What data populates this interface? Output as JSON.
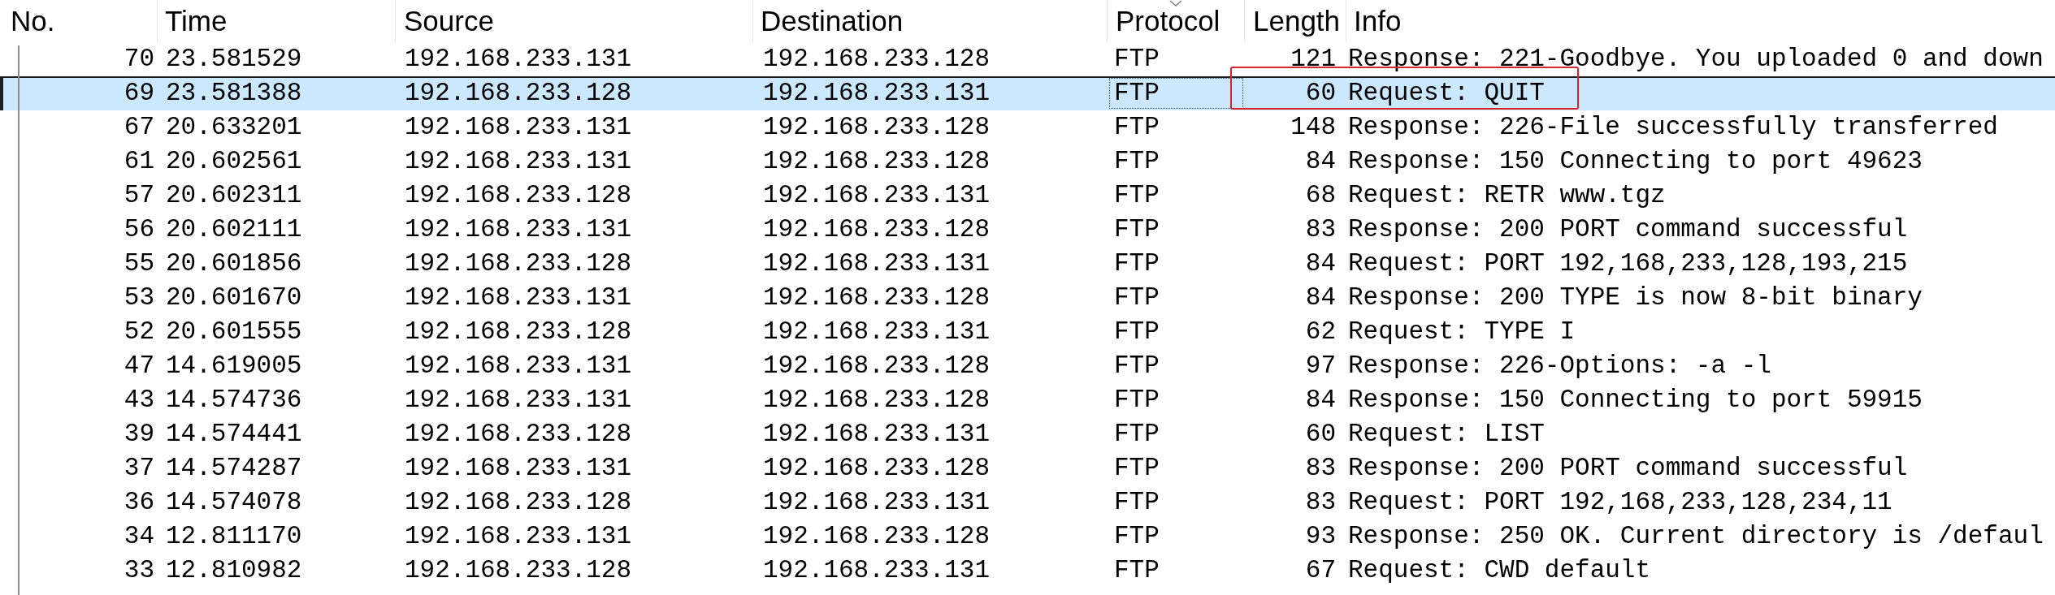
{
  "packet_list": {
    "columns": [
      {
        "label": "No.",
        "sorted": false
      },
      {
        "label": "Time",
        "sorted": false
      },
      {
        "label": "Source",
        "sorted": false
      },
      {
        "label": "Destination",
        "sorted": false
      },
      {
        "label": "Protocol",
        "sorted": true
      },
      {
        "label": "Length",
        "sorted": false
      },
      {
        "label": "Info",
        "sorted": false
      }
    ],
    "rows": [
      {
        "cells": [
          "70",
          "23.581529",
          "192.168.233.131",
          "192.168.233.128",
          "FTP",
          "121",
          "Response: 221-Goodbye. You uploaded 0 and down"
        ],
        "selected": false,
        "annotated": false
      },
      {
        "cells": [
          "69",
          "23.581388",
          "192.168.233.128",
          "192.168.233.131",
          "FTP",
          "60",
          "Request: QUIT"
        ],
        "selected": true,
        "annotated": true
      },
      {
        "cells": [
          "67",
          "20.633201",
          "192.168.233.131",
          "192.168.233.128",
          "FTP",
          "148",
          "Response: 226-File successfully transferred"
        ],
        "selected": false,
        "annotated": false
      },
      {
        "cells": [
          "61",
          "20.602561",
          "192.168.233.131",
          "192.168.233.128",
          "FTP",
          "84",
          "Response: 150 Connecting to port 49623"
        ],
        "selected": false,
        "annotated": false
      },
      {
        "cells": [
          "57",
          "20.602311",
          "192.168.233.128",
          "192.168.233.131",
          "FTP",
          "68",
          "Request: RETR www.tgz"
        ],
        "selected": false,
        "annotated": false
      },
      {
        "cells": [
          "56",
          "20.602111",
          "192.168.233.131",
          "192.168.233.128",
          "FTP",
          "83",
          "Response: 200 PORT command successful"
        ],
        "selected": false,
        "annotated": false
      },
      {
        "cells": [
          "55",
          "20.601856",
          "192.168.233.128",
          "192.168.233.131",
          "FTP",
          "84",
          "Request: PORT 192,168,233,128,193,215"
        ],
        "selected": false,
        "annotated": false
      },
      {
        "cells": [
          "53",
          "20.601670",
          "192.168.233.131",
          "192.168.233.128",
          "FTP",
          "84",
          "Response: 200 TYPE is now 8-bit binary"
        ],
        "selected": false,
        "annotated": false
      },
      {
        "cells": [
          "52",
          "20.601555",
          "192.168.233.128",
          "192.168.233.131",
          "FTP",
          "62",
          "Request: TYPE I"
        ],
        "selected": false,
        "annotated": false
      },
      {
        "cells": [
          "47",
          "14.619005",
          "192.168.233.131",
          "192.168.233.128",
          "FTP",
          "97",
          "Response: 226-Options: -a -l"
        ],
        "selected": false,
        "annotated": false
      },
      {
        "cells": [
          "43",
          "14.574736",
          "192.168.233.131",
          "192.168.233.128",
          "FTP",
          "84",
          "Response: 150 Connecting to port 59915"
        ],
        "selected": false,
        "annotated": false
      },
      {
        "cells": [
          "39",
          "14.574441",
          "192.168.233.128",
          "192.168.233.131",
          "FTP",
          "60",
          "Request: LIST"
        ],
        "selected": false,
        "annotated": false
      },
      {
        "cells": [
          "37",
          "14.574287",
          "192.168.233.131",
          "192.168.233.128",
          "FTP",
          "83",
          "Response: 200 PORT command successful"
        ],
        "selected": false,
        "annotated": false
      },
      {
        "cells": [
          "36",
          "14.574078",
          "192.168.233.128",
          "192.168.233.131",
          "FTP",
          "83",
          "Request: PORT 192,168,233,128,234,11"
        ],
        "selected": false,
        "annotated": false
      },
      {
        "cells": [
          "34",
          "12.811170",
          "192.168.233.131",
          "192.168.233.128",
          "FTP",
          "93",
          "Response: 250 OK. Current directory is /defaul"
        ],
        "selected": false,
        "annotated": false
      },
      {
        "cells": [
          "33",
          "12.810982",
          "192.168.233.128",
          "192.168.233.131",
          "FTP",
          "67",
          "Request: CWD default"
        ],
        "selected": false,
        "annotated": false
      }
    ]
  }
}
